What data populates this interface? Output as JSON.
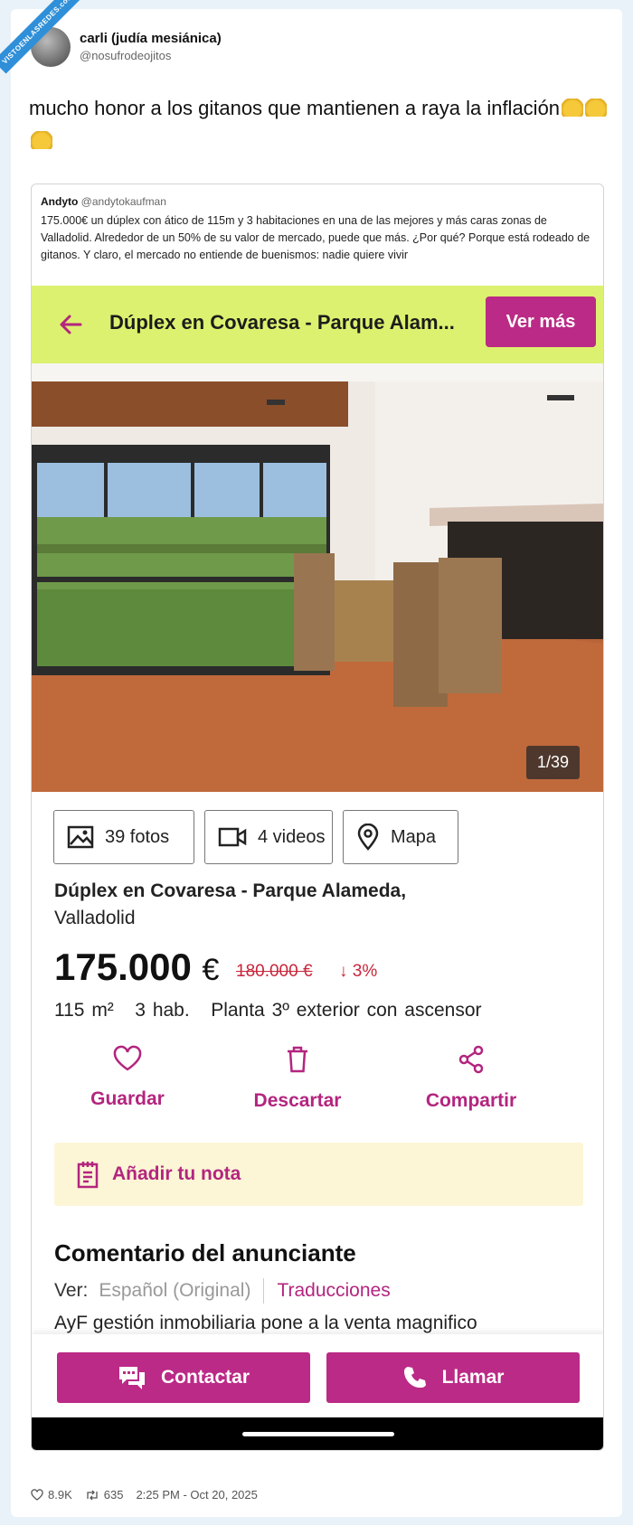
{
  "watermark": "VISTOENLASREDES.com",
  "tweet": {
    "author_name": "carli (judía mesiánica)",
    "author_handle": "@nosufrodeojitos",
    "text": "mucho honor a los gitanos que mantienen a raya la inflación",
    "likes": "8.9K",
    "retweets": "635",
    "timestamp": "2:25 PM - Oct 20, 2025"
  },
  "quoted": {
    "author_name": "Andyto",
    "author_handle": "@andytokaufman",
    "text": "175.000€ un dúplex con ático de 115m y 3 habitaciones en una de las mejores y más caras zonas de Valladolid. Alrededor de un 50% de su valor de mercado, puede que más. ¿Por qué? Porque está rodeado de gitanos. Y claro, el mercado no entiende de buenismos: nadie quiere vivir"
  },
  "app": {
    "header_title": "Dúplex en Covaresa - Parque Alam...",
    "ver_mas": "Ver más",
    "photo_counter": "1/39",
    "media": {
      "photos": "39 fotos",
      "videos": "4 videos",
      "map": "Mapa"
    },
    "title_bold": "Dúplex en Covaresa - Parque Alameda,",
    "title_city": "Valladolid",
    "price": "175.000",
    "currency": "€",
    "old_price": "180.000 €",
    "drop": "3%",
    "features": "115 m²   3 hab.   Planta 3º exterior con ascensor",
    "actions": {
      "save": "Guardar",
      "discard": "Descartar",
      "share": "Compartir"
    },
    "note": "Añadir tu nota",
    "comment_title": "Comentario del anunciante",
    "lang_label": "Ver:",
    "lang_original": "Español (Original)",
    "lang_translations": "Traducciones",
    "description": "AyF gestión inmobiliaria pone a la venta magnifico",
    "contact": "Contactar",
    "call": "Llamar"
  },
  "colors": {
    "accent": "#bb2a86",
    "header_bg": "#dcf16f",
    "price_drop": "#c8253b",
    "note_bg": "#fcf6d6"
  }
}
